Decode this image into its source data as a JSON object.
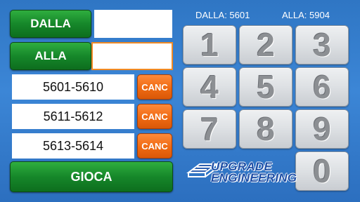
{
  "left": {
    "from_button": "DALLA",
    "from_value": "",
    "to_button": "ALLA",
    "to_value": "",
    "ranges": [
      {
        "label": "5601-5610",
        "cancel": "CANC"
      },
      {
        "label": "5611-5612",
        "cancel": "CANC"
      },
      {
        "label": "5613-5614",
        "cancel": "CANC"
      }
    ],
    "play_button": "GIOCA"
  },
  "header": {
    "from_label": "DALLA: 5601",
    "to_label": "ALLA: 5904"
  },
  "keypad": {
    "keys": [
      "1",
      "2",
      "3",
      "4",
      "5",
      "6",
      "7",
      "8",
      "9",
      "0"
    ]
  },
  "logo": {
    "line1": "UPGRADE",
    "line2": "ENGINEERING"
  },
  "colors": {
    "background": "#3380cf",
    "green_button": "#16872a",
    "cancel_button": "#ef6a12",
    "focus_border": "#f08a24",
    "key_face": "#dfe2e5"
  },
  "icons": {
    "logo_mark": "circuit-board-icon"
  }
}
